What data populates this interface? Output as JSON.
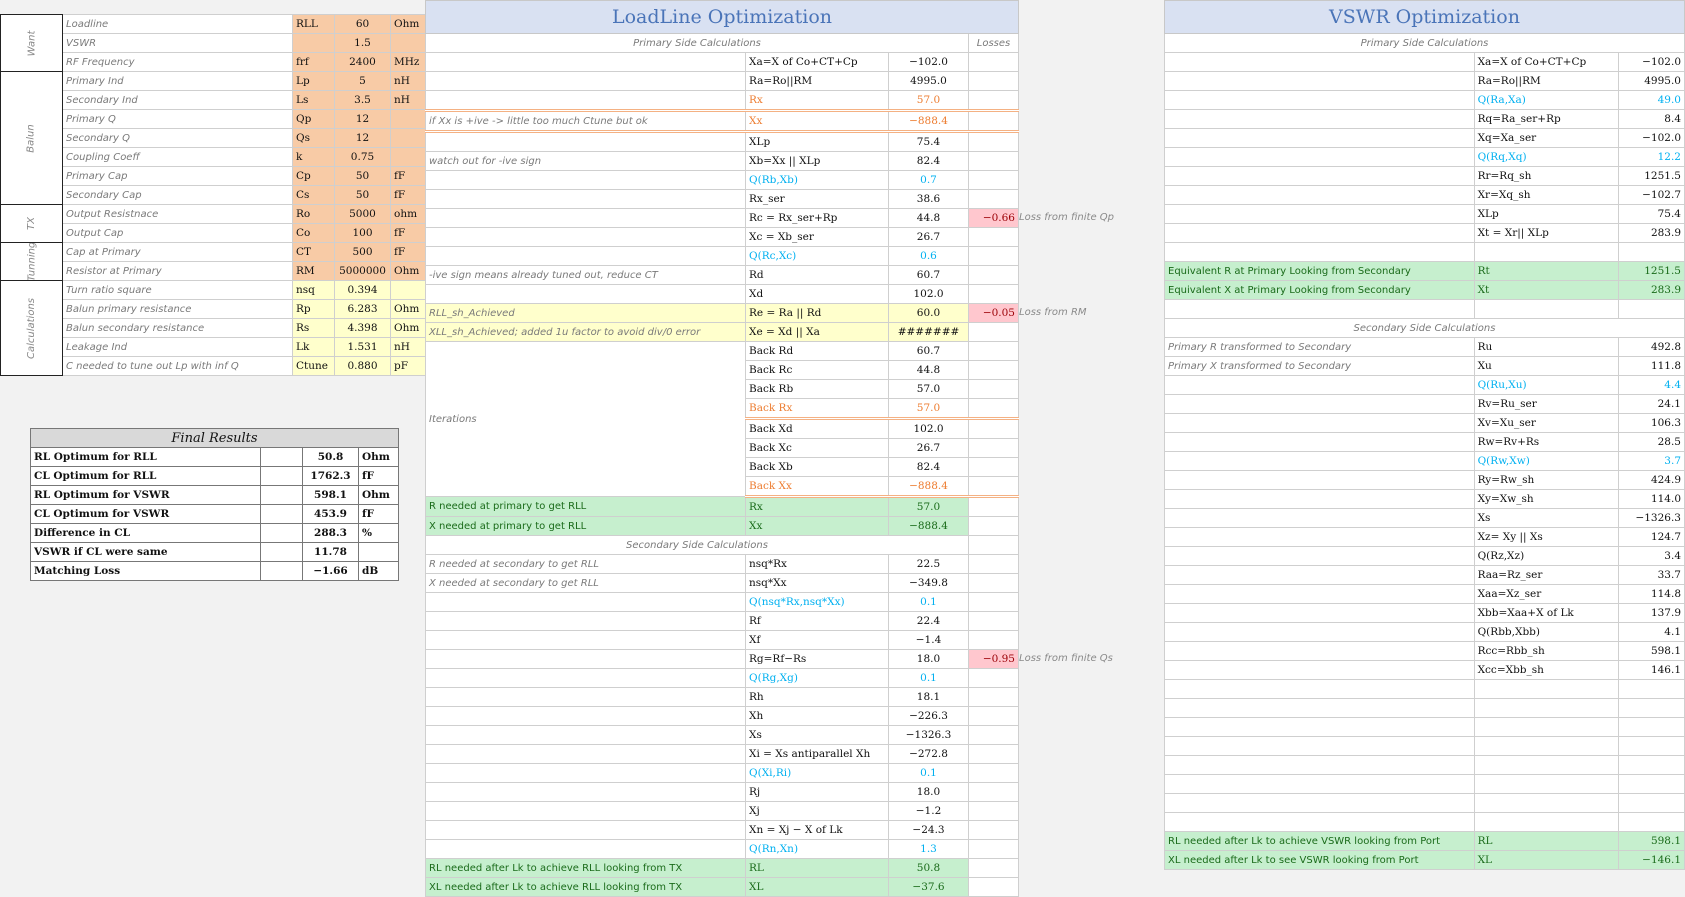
{
  "inputs": {
    "rows": [
      {
        "label": "Loadline",
        "sym": "RLL",
        "val": "60",
        "unit": "Ohm",
        "style": "org"
      },
      {
        "label": "VSWR",
        "sym": "",
        "val": "1.5",
        "unit": "",
        "style": "org"
      },
      {
        "label": "RF Frequency",
        "sym": "frf",
        "val": "2400",
        "unit": "MHz",
        "style": "org"
      },
      {
        "label": "Primary Ind",
        "sym": "Lp",
        "val": "5",
        "unit": "nH",
        "style": "org"
      },
      {
        "label": "Secondary Ind",
        "sym": "Ls",
        "val": "3.5",
        "unit": "nH",
        "style": "org"
      },
      {
        "label": "Primary Q",
        "sym": "Qp",
        "val": "12",
        "unit": "",
        "style": "org"
      },
      {
        "label": "Secondary Q",
        "sym": "Qs",
        "val": "12",
        "unit": "",
        "style": "org"
      },
      {
        "label": "Coupling Coeff",
        "sym": "k",
        "val": "0.75",
        "unit": "",
        "style": "org"
      },
      {
        "label": "Primary Cap",
        "sym": "Cp",
        "val": "50",
        "unit": "fF",
        "style": "org"
      },
      {
        "label": "Secondary Cap",
        "sym": "Cs",
        "val": "50",
        "unit": "fF",
        "style": "org"
      },
      {
        "label": "Output Resistnace",
        "sym": "Ro",
        "val": "5000",
        "unit": "ohm",
        "style": "org"
      },
      {
        "label": "Output Cap",
        "sym": "Co",
        "val": "100",
        "unit": "fF",
        "style": "org"
      },
      {
        "label": "Cap at Primary",
        "sym": "CT",
        "val": "500",
        "unit": "fF",
        "style": "org"
      },
      {
        "label": "Resistor at Primary",
        "sym": "RM",
        "val": "5000000",
        "unit": "Ohm",
        "style": "org"
      },
      {
        "label": "Turn ratio square",
        "sym": "nsq",
        "val": "0.394",
        "unit": "",
        "style": "yel"
      },
      {
        "label": "Balun primary resistance",
        "sym": "Rp",
        "val": "6.283",
        "unit": "Ohm",
        "style": "yel"
      },
      {
        "label": "Balun secondary resistance",
        "sym": "Rs",
        "val": "4.398",
        "unit": "Ohm",
        "style": "yel"
      },
      {
        "label": "Leakage Ind",
        "sym": "Lk",
        "val": "1.531",
        "unit": "nH",
        "style": "yel"
      },
      {
        "label": "C needed to tune out Lp with inf Q",
        "sym": "Ctune",
        "val": "0.880",
        "unit": "pF",
        "style": "yel"
      }
    ],
    "groups": [
      "Want",
      "Balun",
      "TX",
      "Tunning",
      "Calculations"
    ]
  },
  "final": {
    "title": "Final Results",
    "rows": [
      {
        "label": "RL Optimum for RLL",
        "val": "50.8",
        "unit": "Ohm"
      },
      {
        "label": "CL Optimum for RLL",
        "val": "1762.3",
        "unit": "fF"
      },
      {
        "label": "RL Optimum for VSWR",
        "val": "598.1",
        "unit": "Ohm"
      },
      {
        "label": "CL Optimum for VSWR",
        "val": "453.9",
        "unit": "fF"
      },
      {
        "label": "Difference in CL",
        "val": "288.3",
        "unit": "%"
      },
      {
        "label": "VSWR if CL were same",
        "val": "11.78",
        "unit": ""
      },
      {
        "label": "Matching Loss",
        "val": "−1.66",
        "unit": "dB"
      }
    ]
  },
  "loadline": {
    "title": "LoadLine Optimization",
    "primary_header": "Primary Side Calculations",
    "losses_header": "Losses",
    "secondary_header": "Secondary Side Calculations",
    "iterations_label": "Iterations",
    "rows": [
      {
        "note": "",
        "sym": "Xa=X of Co+CT+Cp",
        "val": "−102.0",
        "loss": "",
        "lossnote": "",
        "c": ""
      },
      {
        "note": "",
        "sym": "Ra=Ro||RM",
        "val": "4995.0",
        "loss": "",
        "lossnote": "",
        "c": ""
      },
      {
        "note": "",
        "sym": "Rx",
        "val": "57.0",
        "loss": "",
        "lossnote": "",
        "c": "orng"
      },
      {
        "note": "if Xx is +ive -> little too much Ctune but ok",
        "sym": "Xx",
        "val": "−888.4",
        "loss": "",
        "lossnote": "",
        "c": "orng"
      },
      {
        "note": "",
        "sym": "XLp",
        "val": "75.4",
        "loss": "",
        "lossnote": "",
        "c": ""
      },
      {
        "note": "watch out for -ive sign",
        "sym": "Xb=Xx || XLp",
        "val": "82.4",
        "loss": "",
        "lossnote": "",
        "c": ""
      },
      {
        "note": "",
        "sym": "Q(Rb,Xb)",
        "val": "0.7",
        "loss": "",
        "lossnote": "",
        "c": "cyan"
      },
      {
        "note": "",
        "sym": "Rx_ser",
        "val": "38.6",
        "loss": "",
        "lossnote": "",
        "c": ""
      },
      {
        "note": "",
        "sym": "Rc = Rx_ser+Rp",
        "val": "44.8",
        "loss": "−0.66",
        "lossnote": "Loss from finite Qp",
        "c": ""
      },
      {
        "note": "",
        "sym": "Xc = Xb_ser",
        "val": "26.7",
        "loss": "",
        "lossnote": "",
        "c": ""
      },
      {
        "note": "",
        "sym": "Q(Rc,Xc)",
        "val": "0.6",
        "loss": "",
        "lossnote": "",
        "c": "cyan"
      },
      {
        "note": "-ive sign means already tuned out, reduce CT",
        "sym": "Rd",
        "val": "60.7",
        "loss": "",
        "lossnote": "",
        "c": ""
      },
      {
        "note": "",
        "sym": "Xd",
        "val": "102.0",
        "loss": "",
        "lossnote": "",
        "c": ""
      },
      {
        "note": "RLL_sh_Achieved",
        "sym": "Re = Ra || Rd",
        "val": "60.0",
        "loss": "−0.05",
        "lossnote": "Loss from RM",
        "c": "yel"
      },
      {
        "note": "XLL_sh_Achieved; added 1u factor to avoid div/0 error",
        "sym": "Xe = Xd || Xa",
        "val": "#######",
        "loss": "",
        "lossnote": "",
        "c": "yel"
      },
      {
        "note": "",
        "sym": "Back Rd",
        "val": "60.7",
        "loss": "",
        "lossnote": "",
        "c": ""
      },
      {
        "note": "",
        "sym": "Back Rc",
        "val": "44.8",
        "loss": "",
        "lossnote": "",
        "c": ""
      },
      {
        "note": "",
        "sym": "Back Rb",
        "val": "57.0",
        "loss": "",
        "lossnote": "",
        "c": ""
      },
      {
        "note": "",
        "sym": "Back Rx",
        "val": "57.0",
        "loss": "",
        "lossnote": "",
        "c": "orng"
      },
      {
        "note": "",
        "sym": "Back Xd",
        "val": "102.0",
        "loss": "",
        "lossnote": "",
        "c": ""
      },
      {
        "note": "",
        "sym": "Back Xc",
        "val": "26.7",
        "loss": "",
        "lossnote": "",
        "c": ""
      },
      {
        "note": "",
        "sym": "Back Xb",
        "val": "82.4",
        "loss": "",
        "lossnote": "",
        "c": ""
      },
      {
        "note": "",
        "sym": "Back Xx",
        "val": "−888.4",
        "loss": "",
        "lossnote": "",
        "c": "orng"
      },
      {
        "note": "R needed at primary to get RLL",
        "sym": "Rx",
        "val": "57.0",
        "loss": "",
        "lossnote": "",
        "c": "grn"
      },
      {
        "note": "X needed at primary to get RLL",
        "sym": "Xx",
        "val": "−888.4",
        "loss": "",
        "lossnote": "",
        "c": "grn"
      }
    ],
    "rows2": [
      {
        "note": "R needed at secondary to get RLL",
        "sym": "nsq*Rx",
        "val": "22.5",
        "loss": "",
        "lossnote": "",
        "c": ""
      },
      {
        "note": "X needed at secondary to get RLL",
        "sym": "nsq*Xx",
        "val": "−349.8",
        "loss": "",
        "lossnote": "",
        "c": ""
      },
      {
        "note": "",
        "sym": "Q(nsq*Rx,nsq*Xx)",
        "val": "0.1",
        "loss": "",
        "lossnote": "",
        "c": "cyan"
      },
      {
        "note": "",
        "sym": "Rf",
        "val": "22.4",
        "loss": "",
        "lossnote": "",
        "c": ""
      },
      {
        "note": "",
        "sym": "Xf",
        "val": "−1.4",
        "loss": "",
        "lossnote": "",
        "c": ""
      },
      {
        "note": "",
        "sym": "Rg=Rf−Rs",
        "val": "18.0",
        "loss": "−0.95",
        "lossnote": "Loss from finite Qs",
        "c": ""
      },
      {
        "note": "",
        "sym": "Q(Rg,Xg)",
        "val": "0.1",
        "loss": "",
        "lossnote": "",
        "c": "cyan"
      },
      {
        "note": "",
        "sym": "Rh",
        "val": "18.1",
        "loss": "",
        "lossnote": "",
        "c": ""
      },
      {
        "note": "",
        "sym": "Xh",
        "val": "−226.3",
        "loss": "",
        "lossnote": "",
        "c": ""
      },
      {
        "note": "",
        "sym": "Xs",
        "val": "−1326.3",
        "loss": "",
        "lossnote": "",
        "c": ""
      },
      {
        "note": "",
        "sym": "Xi = Xs antiparallel Xh",
        "val": "−272.8",
        "loss": "",
        "lossnote": "",
        "c": ""
      },
      {
        "note": "",
        "sym": "Q(Xi,Ri)",
        "val": "0.1",
        "loss": "",
        "lossnote": "",
        "c": "cyan"
      },
      {
        "note": "",
        "sym": "Rj",
        "val": "18.0",
        "loss": "",
        "lossnote": "",
        "c": ""
      },
      {
        "note": "",
        "sym": "Xj",
        "val": "−1.2",
        "loss": "",
        "lossnote": "",
        "c": ""
      },
      {
        "note": "",
        "sym": "Xn = Xj − X of Lk",
        "val": "−24.3",
        "loss": "",
        "lossnote": "",
        "c": ""
      },
      {
        "note": "",
        "sym": "Q(Rn,Xn)",
        "val": "1.3",
        "loss": "",
        "lossnote": "",
        "c": "cyan"
      },
      {
        "note": "RL needed after Lk to achieve RLL looking from TX",
        "sym": "RL",
        "val": "50.8",
        "loss": "",
        "lossnote": "",
        "c": "grn"
      },
      {
        "note": "XL needed after Lk to achieve RLL looking from TX",
        "sym": "XL",
        "val": "−37.6",
        "loss": "",
        "lossnote": "",
        "c": "grn"
      }
    ]
  },
  "vswr": {
    "title": "VSWR Optimization",
    "primary_header": "Primary Side Calculations",
    "secondary_header": "Secondary Side Calculations",
    "rows": [
      {
        "note": "",
        "sym": "Xa=X of Co+CT+Cp",
        "val": "−102.0",
        "c": ""
      },
      {
        "note": "",
        "sym": "Ra=Ro||RM",
        "val": "4995.0",
        "c": ""
      },
      {
        "note": "",
        "sym": "Q(Ra,Xa)",
        "val": "49.0",
        "c": "cyan"
      },
      {
        "note": "",
        "sym": "Rq=Ra_ser+Rp",
        "val": "8.4",
        "c": ""
      },
      {
        "note": "",
        "sym": "Xq=Xa_ser",
        "val": "−102.0",
        "c": ""
      },
      {
        "note": "",
        "sym": "Q(Rq,Xq)",
        "val": "12.2",
        "c": "cyan"
      },
      {
        "note": "",
        "sym": "Rr=Rq_sh",
        "val": "1251.5",
        "c": ""
      },
      {
        "note": "",
        "sym": "Xr=Xq_sh",
        "val": "−102.7",
        "c": ""
      },
      {
        "note": "",
        "sym": "XLp",
        "val": "75.4",
        "c": ""
      },
      {
        "note": "",
        "sym": "Xt = Xr|| XLp",
        "val": "283.9",
        "c": ""
      },
      {
        "note": "",
        "sym": "",
        "val": "",
        "c": ""
      },
      {
        "note": "Equivalent R at Primary Looking from Secondary",
        "sym": "Rt",
        "val": "1251.5",
        "c": "grn"
      },
      {
        "note": "Equivalent X at Primary Looking from Secondary",
        "sym": "Xt",
        "val": "283.9",
        "c": "grn"
      },
      {
        "note": "",
        "sym": "",
        "val": "",
        "c": ""
      }
    ],
    "rows2": [
      {
        "note": "Primary R transformed to Secondary",
        "sym": "Ru",
        "val": "492.8",
        "c": ""
      },
      {
        "note": "Primary X transformed to Secondary",
        "sym": "Xu",
        "val": "111.8",
        "c": ""
      },
      {
        "note": "",
        "sym": "Q(Ru,Xu)",
        "val": "4.4",
        "c": "cyan"
      },
      {
        "note": "",
        "sym": "Rv=Ru_ser",
        "val": "24.1",
        "c": ""
      },
      {
        "note": "",
        "sym": "Xv=Xu_ser",
        "val": "106.3",
        "c": ""
      },
      {
        "note": "",
        "sym": "Rw=Rv+Rs",
        "val": "28.5",
        "c": ""
      },
      {
        "note": "",
        "sym": "Q(Rw,Xw)",
        "val": "3.7",
        "c": "cyan"
      },
      {
        "note": "",
        "sym": "Ry=Rw_sh",
        "val": "424.9",
        "c": ""
      },
      {
        "note": "",
        "sym": "Xy=Xw_sh",
        "val": "114.0",
        "c": ""
      },
      {
        "note": "",
        "sym": "Xs",
        "val": "−1326.3",
        "c": ""
      },
      {
        "note": "",
        "sym": "Xz= Xy || Xs",
        "val": "124.7",
        "c": ""
      },
      {
        "note": "",
        "sym": "Q(Rz,Xz)",
        "val": "3.4",
        "c": ""
      },
      {
        "note": "",
        "sym": "Raa=Rz_ser",
        "val": "33.7",
        "c": ""
      },
      {
        "note": "",
        "sym": "Xaa=Xz_ser",
        "val": "114.8",
        "c": ""
      },
      {
        "note": "",
        "sym": "Xbb=Xaa+X of Lk",
        "val": "137.9",
        "c": ""
      },
      {
        "note": "",
        "sym": "Q(Rbb,Xbb)",
        "val": "4.1",
        "c": ""
      },
      {
        "note": "",
        "sym": "Rcc=Rbb_sh",
        "val": "598.1",
        "c": ""
      },
      {
        "note": "",
        "sym": "Xcc=Xbb_sh",
        "val": "146.1",
        "c": ""
      },
      {
        "note": "",
        "sym": "",
        "val": "",
        "c": ""
      },
      {
        "note": "",
        "sym": "",
        "val": "",
        "c": ""
      },
      {
        "note": "",
        "sym": "",
        "val": "",
        "c": ""
      },
      {
        "note": "",
        "sym": "",
        "val": "",
        "c": ""
      },
      {
        "note": "",
        "sym": "",
        "val": "",
        "c": ""
      },
      {
        "note": "",
        "sym": "",
        "val": "",
        "c": ""
      },
      {
        "note": "",
        "sym": "",
        "val": "",
        "c": ""
      },
      {
        "note": "",
        "sym": "",
        "val": "",
        "c": ""
      },
      {
        "note": "RL needed after Lk to achieve VSWR looking from Port",
        "sym": "RL",
        "val": "598.1",
        "c": "grn"
      },
      {
        "note": "XL needed after Lk to see VSWR looking from Port",
        "sym": "XL",
        "val": "−146.1",
        "c": "grn"
      }
    ]
  }
}
